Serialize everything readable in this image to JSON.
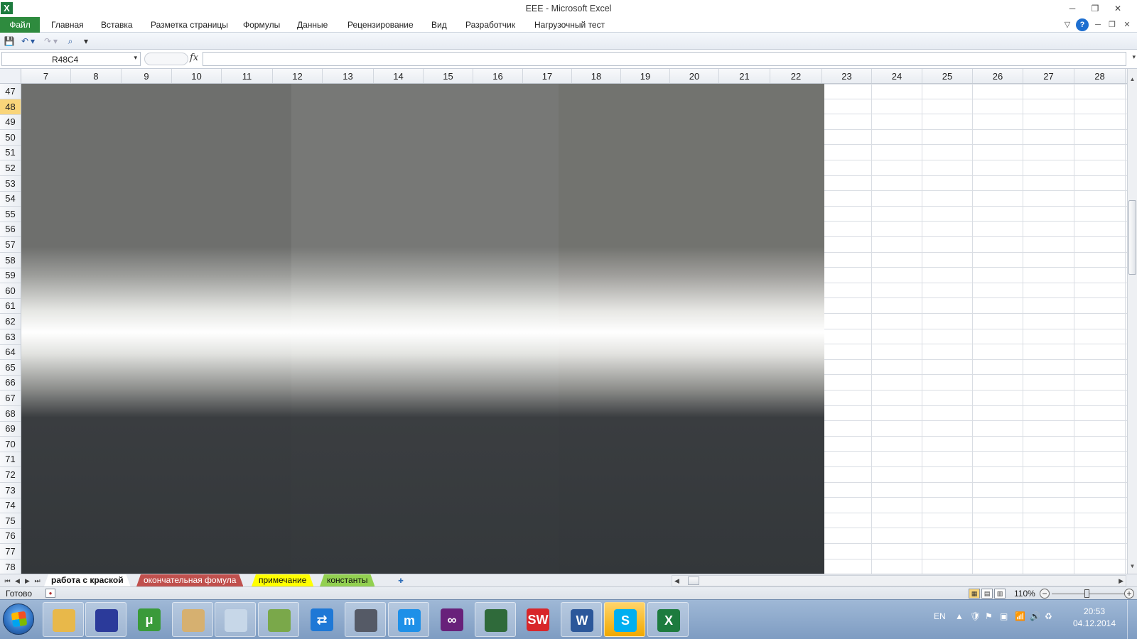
{
  "window": {
    "title": "EEE  -  Microsoft Excel",
    "app_icon": "X",
    "controls": {
      "minimize": "─",
      "restore": "❐",
      "close": "✕"
    }
  },
  "ribbon": {
    "tabs": [
      "Файл",
      "Главная",
      "Вставка",
      "Разметка страницы",
      "Формулы",
      "Данные",
      "Рецензирование",
      "Вид",
      "Разработчик",
      "Нагрузочный тест"
    ],
    "right_icons": {
      "collapse": "▽",
      "help": "?",
      "min": "─",
      "restore": "❐",
      "close": "✕"
    }
  },
  "qat": {
    "save": "💾",
    "undo": "↶",
    "undo_dd": "▾",
    "redo": "↷",
    "redo_dd": "▾",
    "find": "⌕",
    "customize": "▾"
  },
  "formula_bar": {
    "name_box": "R48C4",
    "name_dd": "▾",
    "fx": "fx",
    "formula": "",
    "expand": "▾"
  },
  "grid": {
    "columns": [
      "7",
      "8",
      "9",
      "10",
      "11",
      "12",
      "13",
      "14",
      "15",
      "16",
      "17",
      "18",
      "19",
      "20",
      "21",
      "22",
      "23",
      "24",
      "25",
      "26",
      "27",
      "28"
    ],
    "rows": [
      "47",
      "48",
      "49",
      "50",
      "51",
      "52",
      "53",
      "54",
      "55",
      "56",
      "57",
      "58",
      "59",
      "60",
      "61",
      "62",
      "63",
      "64",
      "65",
      "66",
      "67",
      "68",
      "69",
      "70",
      "71",
      "72",
      "73",
      "74",
      "75",
      "76",
      "77",
      "78"
    ],
    "selected_row": "48",
    "fill_colors": {
      "top": "#737472",
      "highlight": "#ffffff",
      "bottom": "#33373a"
    }
  },
  "scrollbars": {
    "up": "▲",
    "down": "▼",
    "left": "◀",
    "right": "▶",
    "grip": "III"
  },
  "sheet_tabs": {
    "nav": [
      "⏮",
      "◀",
      "▶",
      "⏭"
    ],
    "tabs": [
      {
        "label": "работа с краской",
        "color": "#ffffff",
        "text": "#111111"
      },
      {
        "label": "окончательная фомула",
        "color": "#c0504d",
        "text": "#ffffff"
      },
      {
        "label": "примечание",
        "color": "#ffff00",
        "text": "#111111"
      },
      {
        "label": "константы",
        "color": "#92d050",
        "text": "#111111"
      }
    ],
    "new_sheet": "✚"
  },
  "status_bar": {
    "ready": "Готово",
    "zoom": "110%",
    "zoom_out": "−",
    "zoom_in": "+"
  },
  "taskbar": {
    "apps": [
      {
        "name": "explorer",
        "label": "",
        "color": "#e8b84a"
      },
      {
        "name": "save-app",
        "label": "",
        "color": "#2b3a9a"
      },
      {
        "name": "utorrent",
        "label": "μ",
        "color": "#3a9a3a"
      },
      {
        "name": "paint",
        "label": "",
        "color": "#d6b070"
      },
      {
        "name": "calculator",
        "label": "",
        "color": "#c7d7e8"
      },
      {
        "name": "notepad",
        "label": "",
        "color": "#7aa84a"
      },
      {
        "name": "teamviewer",
        "label": "⇄",
        "color": "#1e78d6"
      },
      {
        "name": "camera",
        "label": "",
        "color": "#555a66"
      },
      {
        "name": "maxthon",
        "label": "m",
        "color": "#1e90e8"
      },
      {
        "name": "visual-studio",
        "label": "∞",
        "color": "#68217a"
      },
      {
        "name": "media-app",
        "label": "",
        "color": "#2f6a3a"
      },
      {
        "name": "solidworks",
        "label": "SW",
        "color": "#d8262a"
      },
      {
        "name": "word",
        "label": "W",
        "color": "#2b579a"
      },
      {
        "name": "skype",
        "label": "S",
        "color": "#00aff0"
      },
      {
        "name": "excel",
        "label": "X",
        "color": "#1d7b3e"
      }
    ],
    "lang": "EN",
    "tray_icons": [
      "▲",
      "🛡",
      "⚑",
      "▣",
      "📶",
      "🔊",
      "♻"
    ],
    "time": "20:53",
    "date": "04.12.2014"
  }
}
